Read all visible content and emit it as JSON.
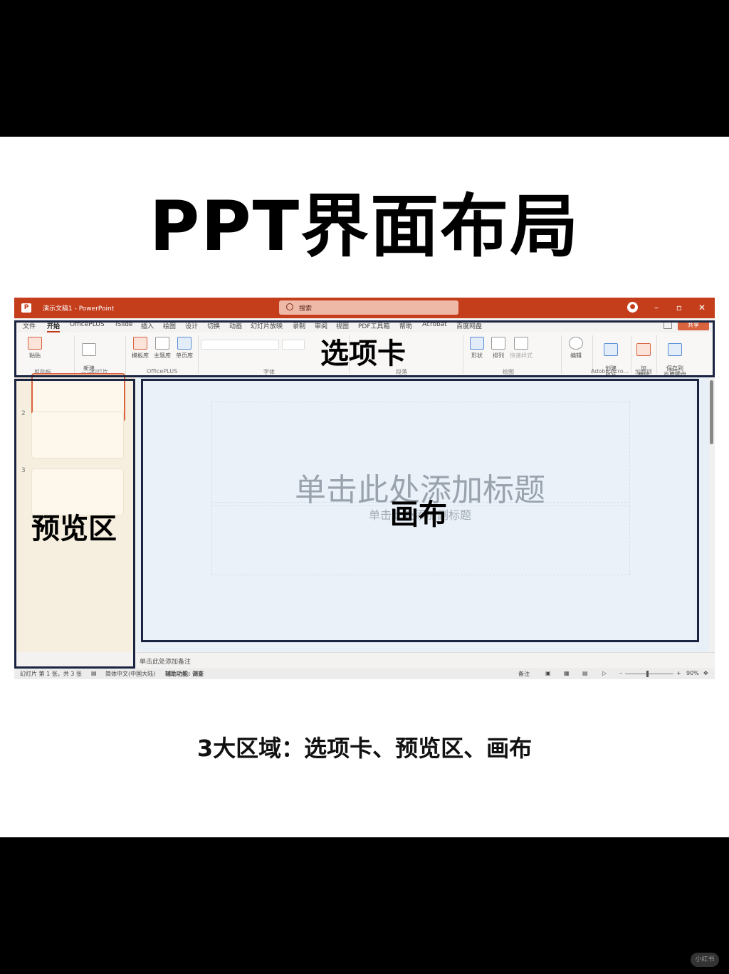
{
  "headline": "PPT界面布局",
  "subline": "3大区域：选项卡、预览区、画布",
  "window": {
    "title": "演示文稿1 - PowerPoint",
    "search_placeholder": "搜索",
    "tabs": [
      "文件",
      "开始",
      "OfficePLUS",
      "iSlide",
      "插入",
      "绘图",
      "设计",
      "切换",
      "动画",
      "幻灯片放映",
      "录制",
      "审阅",
      "视图",
      "PDF工具箱",
      "帮助",
      "Acrobat",
      "百度网盘"
    ],
    "active_tab": "开始",
    "share_label": "共享",
    "accent_color": "#c43e1c"
  },
  "ribbon": {
    "buttons": {
      "paste": "粘贴",
      "new_slide": "新建\n幻灯片",
      "template_lib": "模板库",
      "theme_lib": "主题库",
      "page_lib": "单页库",
      "shapes": "形状",
      "arrange": "排列",
      "quick_styles": "快速样式",
      "edit": "编辑",
      "create_pdf": "创建\nPDF",
      "addins": "加\n载项",
      "save_baidu": "保存到\n百度网盘"
    },
    "groups": {
      "clipboard": "剪贴板",
      "slides": "幻灯片",
      "officeplus": "OfficePLUS",
      "font": "字体",
      "paragraph": "段落",
      "drawing": "绘图",
      "adobe": "Adobe Acro...",
      "addins": "加载项",
      "save": "保存"
    }
  },
  "panel": {
    "slide_numbers": [
      "2",
      "3"
    ]
  },
  "slide": {
    "title_placeholder": "单击此处添加标题",
    "subtitle_placeholder": "单击此处添加副标题"
  },
  "notes_placeholder": "单击此处添加备注",
  "status": {
    "slide_info": "幻灯片 第 1 张，共 3 张",
    "language": "简体中文(中国大陆)",
    "accessibility": "辅助功能: 调查",
    "notes": "备注",
    "zoom": "90%"
  },
  "annotations": {
    "tabs_label": "选项卡",
    "preview_label": "预览区",
    "canvas_label": "画布"
  },
  "watermark": "小红书"
}
